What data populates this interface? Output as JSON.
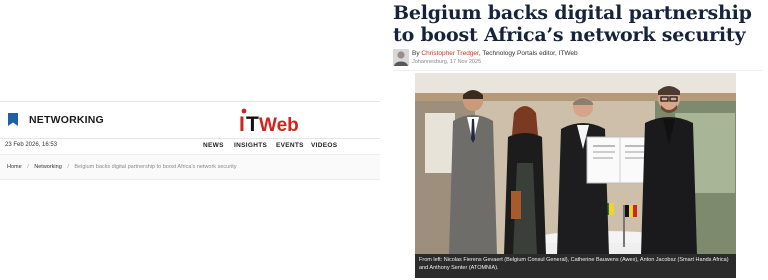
{
  "header": {
    "section_label": "NETWORKING",
    "logo_alt": "ITWeb",
    "logo_i": "I",
    "logo_t": "T",
    "logo_web": "Web"
  },
  "subnav": {
    "date": "23 Feb 2026, 16:53",
    "items": [
      "NEWS",
      "INSIGHTS",
      "EVENTS",
      "VIDEOS"
    ]
  },
  "breadcrumb": {
    "home": "Home",
    "section": "Networking",
    "separator": "/",
    "current": "Belgium backs digital partnership to boost Africa's network security"
  },
  "article": {
    "headline": "Belgium backs digital partnership to boost Africa’s network security",
    "byline_prefix": "By ",
    "author": "Christopher Tredger",
    "author_role": ", Technology Portals editor, ITWeb",
    "dateline": "Johannesburg, 17 Nov 2025",
    "caption": "From left: Nicolas Fierens Gevaert (Belgium Consul General), Catherine Bauwens (Awex), Anton Jacobsz (Smart Hands Africa) and Anthony Senter (ATOMNIA)."
  },
  "colors": {
    "headline": "#16233a",
    "author_link": "#c0392b",
    "logo_red": "#d0251d",
    "bookmark_blue": "#1f5fa8",
    "caption_bg": "#2b2b2b"
  },
  "icons": {
    "section": "bookmark-icon"
  }
}
